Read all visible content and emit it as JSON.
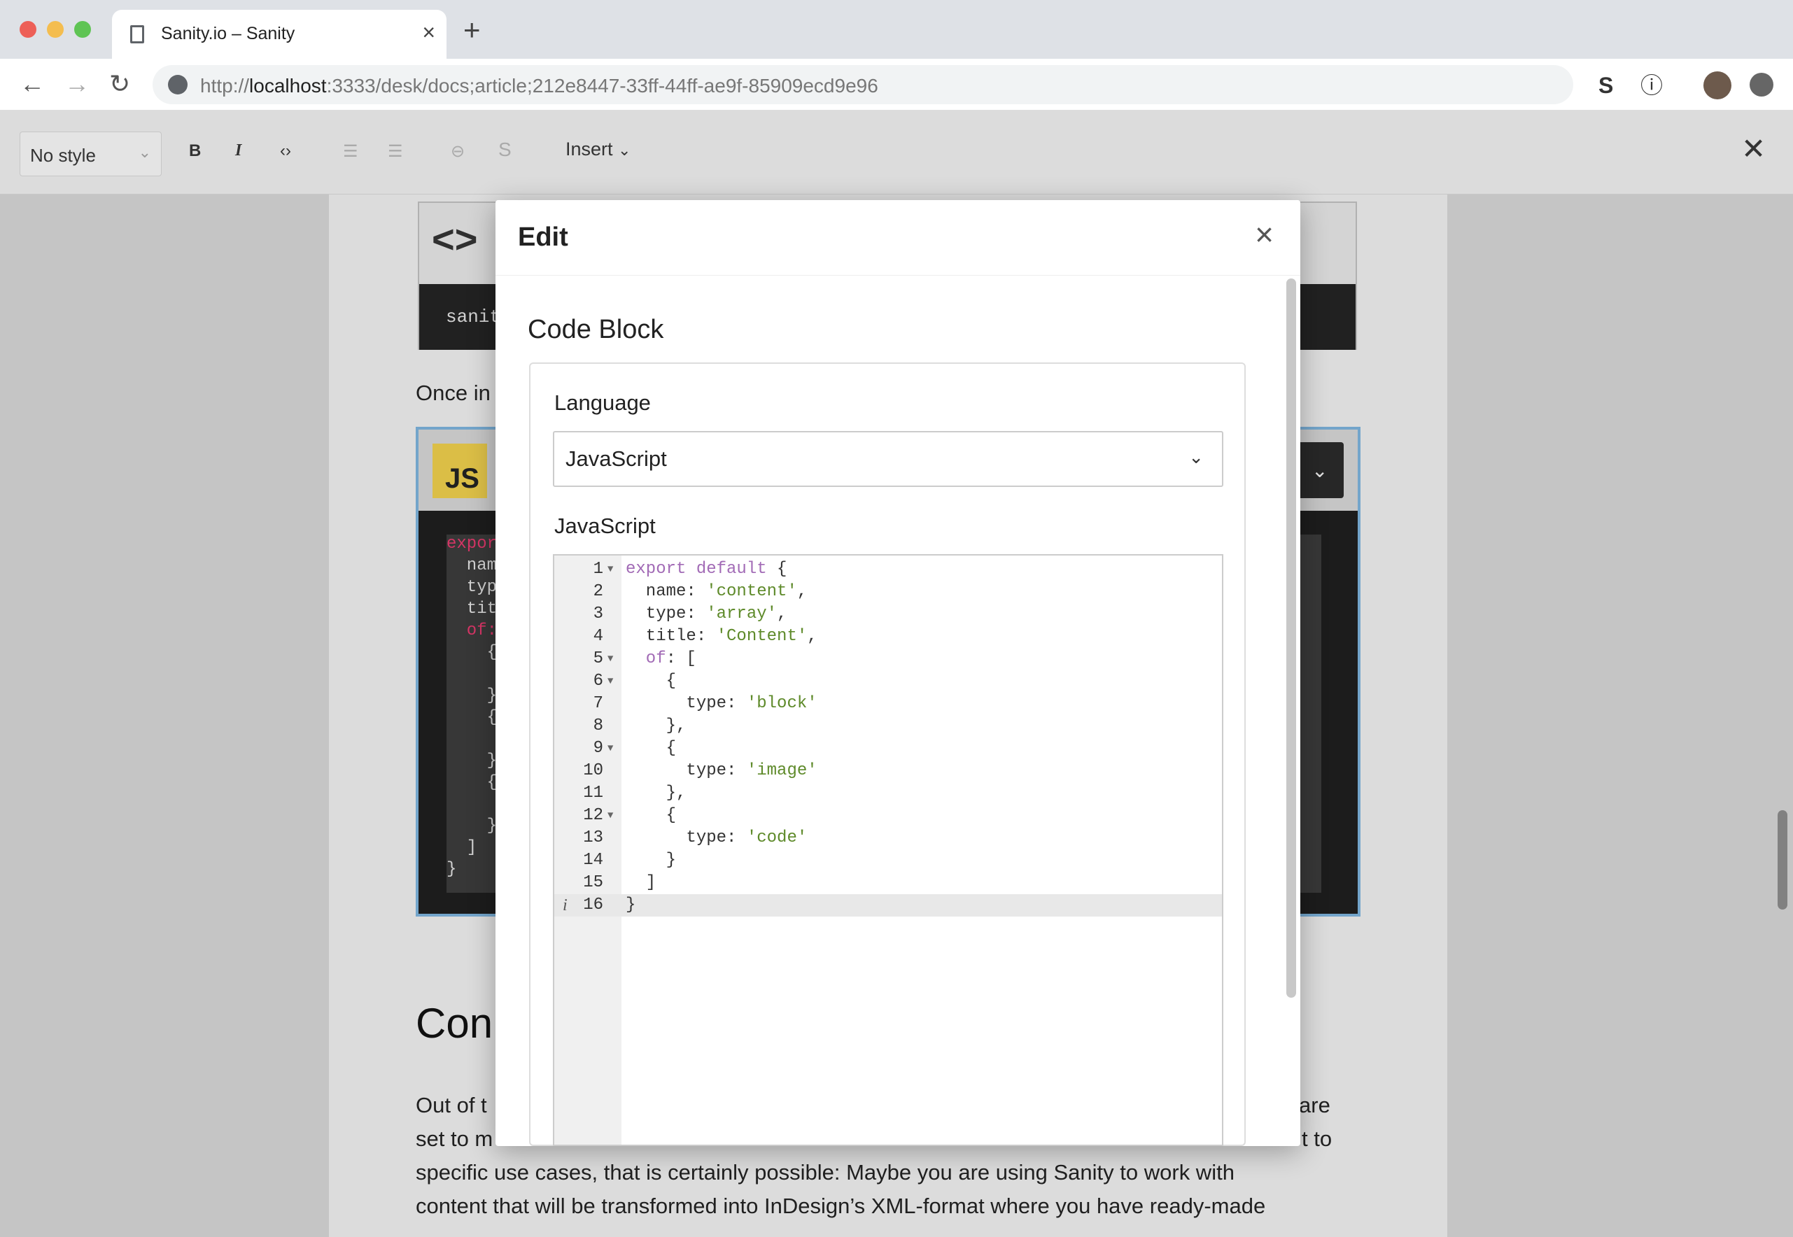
{
  "browser": {
    "tab_title": "Sanity.io – Sanity",
    "tab_close": "×",
    "new_tab": "+",
    "url_prefix": "http://",
    "url_host": "localhost",
    "url_rest": ":3333/desk/docs;article;212e8447-33ff-44ff-ae9f-85909ecd9e96",
    "back": "←",
    "forward": "→",
    "reload": "↻",
    "ext_s": "S",
    "ext_info": "ⓘ"
  },
  "editor_toolbar": {
    "style_value": "No style",
    "bold": "B",
    "italic": "I",
    "code": "‹›",
    "bullet": "☰",
    "numbered": "☰",
    "link": "⊖",
    "strike": "S",
    "insert_label": "Insert",
    "close": "✕"
  },
  "document": {
    "code_icon": "<>",
    "code_snippet": "sanit",
    "para1": "Once in",
    "js_badge": "JS",
    "heading_fragment": "Con",
    "para_line1_start": "Out of t",
    "para_line1_end": "are",
    "para_line2_start": "set to m",
    "para_line2_end": "t to",
    "para_line3": "specific use cases, that is certainly possible: Maybe you are using Sanity to work with",
    "para_line4": "content that will be transformed into InDesign’s XML-format where you have ready-made",
    "bg_code": [
      "expor",
      "  nam",
      "  typ",
      "  tit",
      "  of:",
      "    {",
      "",
      "    }",
      "    {",
      "",
      "    }",
      "    {",
      "",
      "    }",
      "  ]",
      "}"
    ]
  },
  "modal": {
    "title": "Edit",
    "close": "×",
    "section_title": "Code Block",
    "language_label": "Language",
    "language_value": "JavaScript",
    "code_label": "JavaScript",
    "code_lines": [
      {
        "n": "1",
        "fold": true,
        "t": [
          [
            "kw",
            "export default "
          ],
          [
            "",
            "{"
          ]
        ]
      },
      {
        "n": "2",
        "t": [
          [
            "",
            "  name: "
          ],
          [
            "str",
            "'content'"
          ],
          [
            "",
            ","
          ]
        ]
      },
      {
        "n": "3",
        "t": [
          [
            "",
            "  type: "
          ],
          [
            "str",
            "'array'"
          ],
          [
            "",
            ","
          ]
        ]
      },
      {
        "n": "4",
        "t": [
          [
            "",
            "  title: "
          ],
          [
            "str",
            "'Content'"
          ],
          [
            "",
            ","
          ]
        ]
      },
      {
        "n": "5",
        "fold": true,
        "t": [
          [
            "kw",
            "  of"
          ],
          [
            "",
            ": ["
          ]
        ]
      },
      {
        "n": "6",
        "fold": true,
        "t": [
          [
            "",
            "    {"
          ]
        ]
      },
      {
        "n": "7",
        "t": [
          [
            "",
            "      type: "
          ],
          [
            "str",
            "'block'"
          ]
        ]
      },
      {
        "n": "8",
        "t": [
          [
            "",
            "    },"
          ]
        ]
      },
      {
        "n": "9",
        "fold": true,
        "t": [
          [
            "",
            "    {"
          ]
        ]
      },
      {
        "n": "10",
        "t": [
          [
            "",
            "      type: "
          ],
          [
            "str",
            "'image'"
          ]
        ]
      },
      {
        "n": "11",
        "t": [
          [
            "",
            "    },"
          ]
        ]
      },
      {
        "n": "12",
        "fold": true,
        "t": [
          [
            "",
            "    {"
          ]
        ]
      },
      {
        "n": "13",
        "t": [
          [
            "",
            "      type: "
          ],
          [
            "str",
            "'code'"
          ]
        ]
      },
      {
        "n": "14",
        "t": [
          [
            "",
            "    }"
          ]
        ]
      },
      {
        "n": "15",
        "t": [
          [
            "",
            "  ]"
          ]
        ]
      },
      {
        "n": "16",
        "active": true,
        "info": "i",
        "t": [
          [
            "",
            "}"
          ]
        ]
      }
    ]
  }
}
